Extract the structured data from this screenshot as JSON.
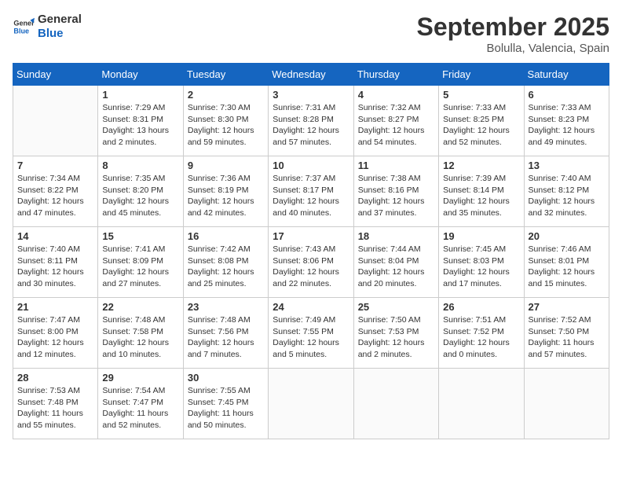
{
  "logo": {
    "line1": "General",
    "line2": "Blue"
  },
  "title": "September 2025",
  "subtitle": "Bolulla, Valencia, Spain",
  "days_header": [
    "Sunday",
    "Monday",
    "Tuesday",
    "Wednesday",
    "Thursday",
    "Friday",
    "Saturday"
  ],
  "weeks": [
    [
      {
        "num": "",
        "info": ""
      },
      {
        "num": "1",
        "info": "Sunrise: 7:29 AM\nSunset: 8:31 PM\nDaylight: 13 hours and 2 minutes."
      },
      {
        "num": "2",
        "info": "Sunrise: 7:30 AM\nSunset: 8:30 PM\nDaylight: 12 hours and 59 minutes."
      },
      {
        "num": "3",
        "info": "Sunrise: 7:31 AM\nSunset: 8:28 PM\nDaylight: 12 hours and 57 minutes."
      },
      {
        "num": "4",
        "info": "Sunrise: 7:32 AM\nSunset: 8:27 PM\nDaylight: 12 hours and 54 minutes."
      },
      {
        "num": "5",
        "info": "Sunrise: 7:33 AM\nSunset: 8:25 PM\nDaylight: 12 hours and 52 minutes."
      },
      {
        "num": "6",
        "info": "Sunrise: 7:33 AM\nSunset: 8:23 PM\nDaylight: 12 hours and 49 minutes."
      }
    ],
    [
      {
        "num": "7",
        "info": "Sunrise: 7:34 AM\nSunset: 8:22 PM\nDaylight: 12 hours and 47 minutes."
      },
      {
        "num": "8",
        "info": "Sunrise: 7:35 AM\nSunset: 8:20 PM\nDaylight: 12 hours and 45 minutes."
      },
      {
        "num": "9",
        "info": "Sunrise: 7:36 AM\nSunset: 8:19 PM\nDaylight: 12 hours and 42 minutes."
      },
      {
        "num": "10",
        "info": "Sunrise: 7:37 AM\nSunset: 8:17 PM\nDaylight: 12 hours and 40 minutes."
      },
      {
        "num": "11",
        "info": "Sunrise: 7:38 AM\nSunset: 8:16 PM\nDaylight: 12 hours and 37 minutes."
      },
      {
        "num": "12",
        "info": "Sunrise: 7:39 AM\nSunset: 8:14 PM\nDaylight: 12 hours and 35 minutes."
      },
      {
        "num": "13",
        "info": "Sunrise: 7:40 AM\nSunset: 8:12 PM\nDaylight: 12 hours and 32 minutes."
      }
    ],
    [
      {
        "num": "14",
        "info": "Sunrise: 7:40 AM\nSunset: 8:11 PM\nDaylight: 12 hours and 30 minutes."
      },
      {
        "num": "15",
        "info": "Sunrise: 7:41 AM\nSunset: 8:09 PM\nDaylight: 12 hours and 27 minutes."
      },
      {
        "num": "16",
        "info": "Sunrise: 7:42 AM\nSunset: 8:08 PM\nDaylight: 12 hours and 25 minutes."
      },
      {
        "num": "17",
        "info": "Sunrise: 7:43 AM\nSunset: 8:06 PM\nDaylight: 12 hours and 22 minutes."
      },
      {
        "num": "18",
        "info": "Sunrise: 7:44 AM\nSunset: 8:04 PM\nDaylight: 12 hours and 20 minutes."
      },
      {
        "num": "19",
        "info": "Sunrise: 7:45 AM\nSunset: 8:03 PM\nDaylight: 12 hours and 17 minutes."
      },
      {
        "num": "20",
        "info": "Sunrise: 7:46 AM\nSunset: 8:01 PM\nDaylight: 12 hours and 15 minutes."
      }
    ],
    [
      {
        "num": "21",
        "info": "Sunrise: 7:47 AM\nSunset: 8:00 PM\nDaylight: 12 hours and 12 minutes."
      },
      {
        "num": "22",
        "info": "Sunrise: 7:48 AM\nSunset: 7:58 PM\nDaylight: 12 hours and 10 minutes."
      },
      {
        "num": "23",
        "info": "Sunrise: 7:48 AM\nSunset: 7:56 PM\nDaylight: 12 hours and 7 minutes."
      },
      {
        "num": "24",
        "info": "Sunrise: 7:49 AM\nSunset: 7:55 PM\nDaylight: 12 hours and 5 minutes."
      },
      {
        "num": "25",
        "info": "Sunrise: 7:50 AM\nSunset: 7:53 PM\nDaylight: 12 hours and 2 minutes."
      },
      {
        "num": "26",
        "info": "Sunrise: 7:51 AM\nSunset: 7:52 PM\nDaylight: 12 hours and 0 minutes."
      },
      {
        "num": "27",
        "info": "Sunrise: 7:52 AM\nSunset: 7:50 PM\nDaylight: 11 hours and 57 minutes."
      }
    ],
    [
      {
        "num": "28",
        "info": "Sunrise: 7:53 AM\nSunset: 7:48 PM\nDaylight: 11 hours and 55 minutes."
      },
      {
        "num": "29",
        "info": "Sunrise: 7:54 AM\nSunset: 7:47 PM\nDaylight: 11 hours and 52 minutes."
      },
      {
        "num": "30",
        "info": "Sunrise: 7:55 AM\nSunset: 7:45 PM\nDaylight: 11 hours and 50 minutes."
      },
      {
        "num": "",
        "info": ""
      },
      {
        "num": "",
        "info": ""
      },
      {
        "num": "",
        "info": ""
      },
      {
        "num": "",
        "info": ""
      }
    ]
  ]
}
